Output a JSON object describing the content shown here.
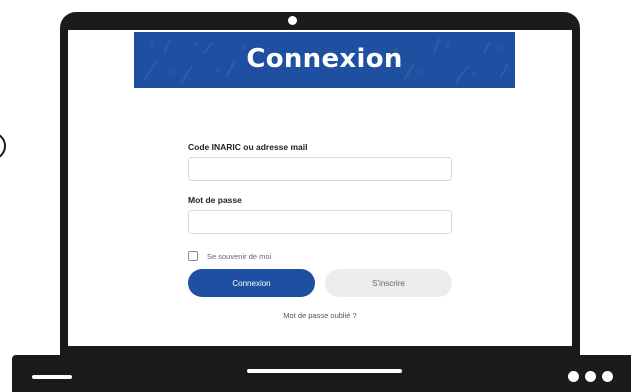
{
  "banner": {
    "title": "Connexion"
  },
  "form": {
    "login_label": "Code INARIC ou adresse mail",
    "login_value": "",
    "password_label": "Mot de passe",
    "password_value": "",
    "remember_label": "Se souvenir de moi",
    "remember_checked": false,
    "login_button": "Connexion",
    "signup_button": "S'inscrire",
    "forgot_link": "Mot de passe oublié ?"
  },
  "colors": {
    "brand_blue": "#1f4fa0",
    "device_black": "#1b1b1b",
    "secondary_button": "#ececec"
  },
  "icons": {
    "camera": "camera-dot-icon",
    "base_menu": "three-dots-icon"
  }
}
